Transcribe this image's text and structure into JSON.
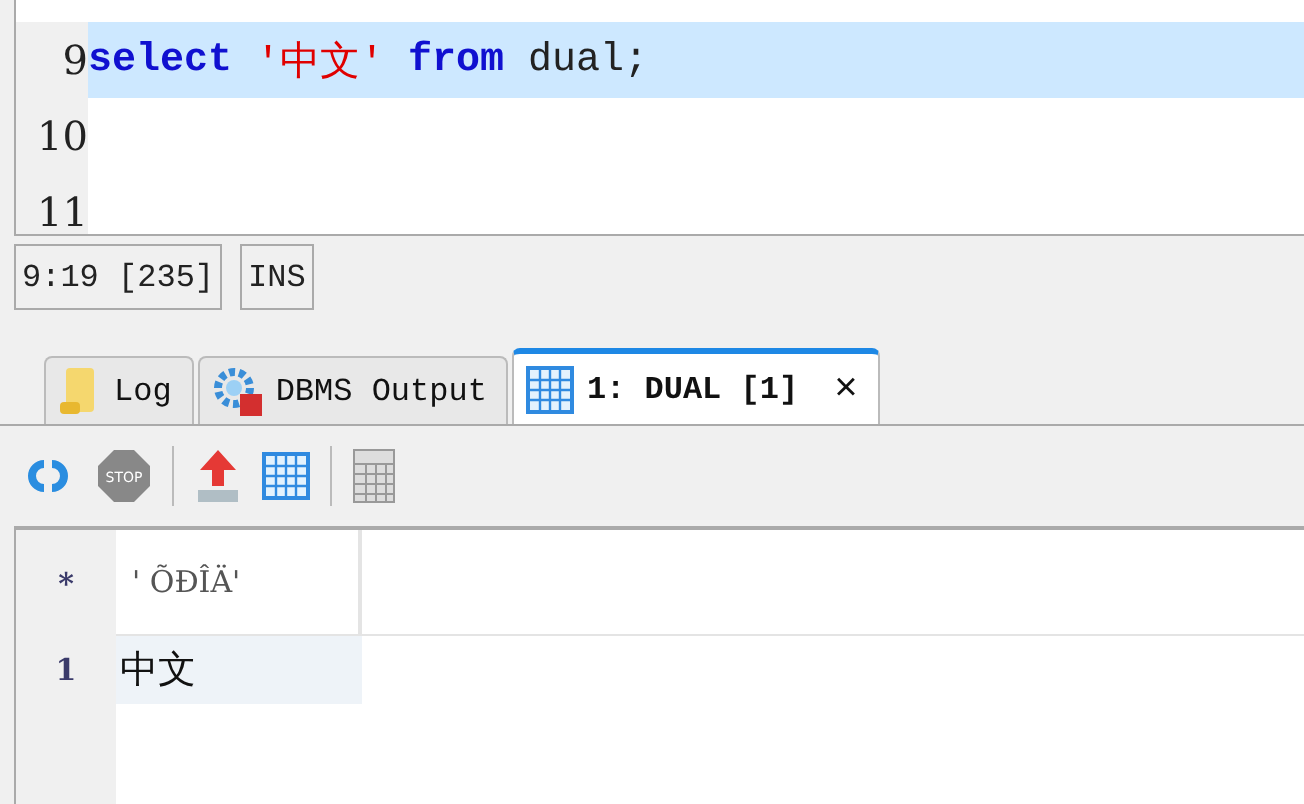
{
  "editor": {
    "lines": [
      {
        "number": "9",
        "selected": true,
        "tokens": [
          {
            "kind": "keyword",
            "text": "select"
          },
          {
            "kind": "string",
            "text": " '中文' "
          },
          {
            "kind": "keyword",
            "text": "from"
          },
          {
            "kind": "plain",
            "text": " dual;"
          }
        ]
      },
      {
        "number": "10",
        "selected": false
      },
      {
        "number": "11",
        "selected": false
      }
    ]
  },
  "status_bar": [
    "9:19 [235]",
    "INS"
  ],
  "tabs": [
    {
      "label": "Log",
      "selected": false
    },
    {
      "label": "DBMS Output",
      "selected": false
    },
    {
      "label": "1: DUAL [1]",
      "selected": true,
      "close": "×"
    }
  ],
  "toolbar": [
    {
      "kind": "refresh"
    },
    {
      "kind": "stop",
      "label": "STOP"
    },
    {
      "kind": "sep"
    },
    {
      "kind": "export"
    },
    {
      "kind": "grid"
    },
    {
      "kind": "sep"
    },
    {
      "kind": "calc"
    }
  ],
  "grid": {
    "header_marker": "*",
    "columns": [
      "' ÕÐÎÄ'"
    ],
    "rows": [
      {
        "number": "1",
        "cells": [
          "中文"
        ],
        "selected": true
      }
    ]
  }
}
